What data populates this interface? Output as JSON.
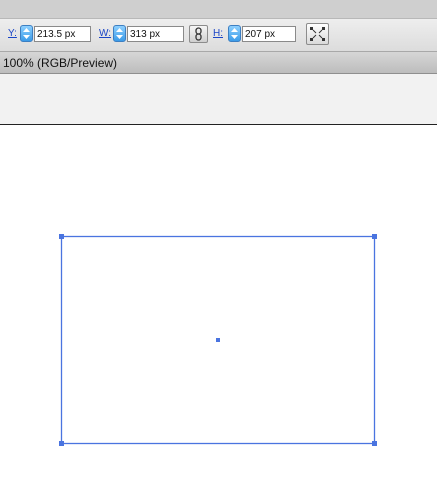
{
  "controls": {
    "y_label": "Y:",
    "y_value": "213.5 px",
    "w_label": "W:",
    "w_value": "313 px",
    "h_label": "H:",
    "h_value": "207 px"
  },
  "document": {
    "title": "100% (RGB/Preview)"
  },
  "colors": {
    "selection": "#4a74e0",
    "label": "#1a45c7",
    "stepper": "#3b9be8"
  },
  "icons": {
    "link": "link-chain-icon",
    "transform": "transform-handles-icon",
    "stepper": "up-down-arrows-icon"
  }
}
